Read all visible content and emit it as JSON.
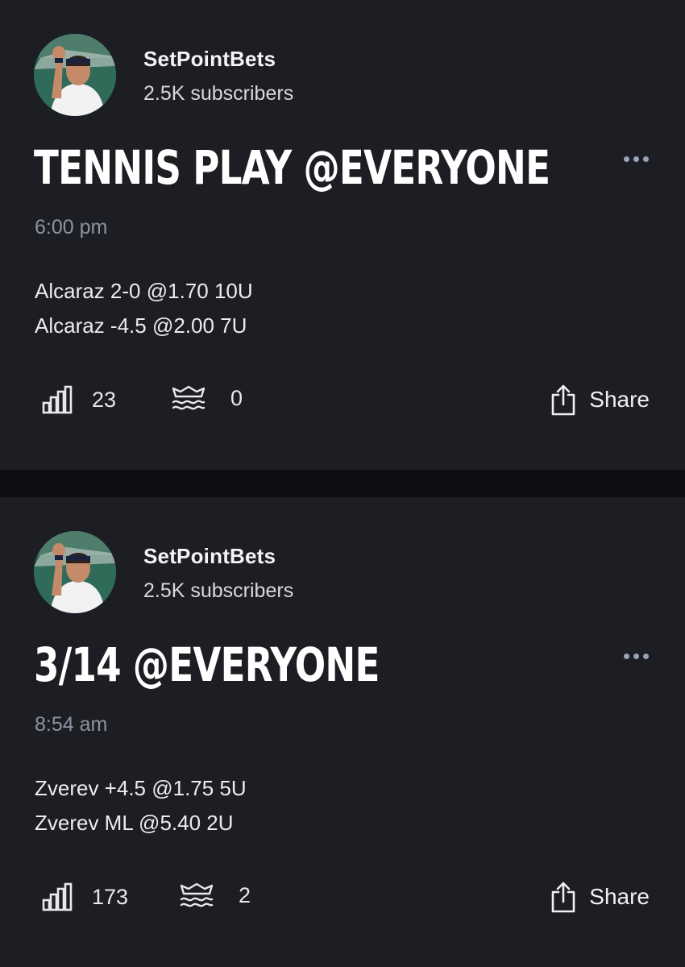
{
  "posts": [
    {
      "channel": "SetPointBets",
      "subscribers": "2.5K subscribers",
      "title": "TENNIS PLAY @EVERYONE",
      "time": "6:00 pm",
      "lines": [
        "Alcaraz 2-0 @1.70 10U",
        "Alcaraz -4.5 @2.00 7U"
      ],
      "views": "23",
      "reactions": "0",
      "share_label": "Share"
    },
    {
      "channel": "SetPointBets",
      "subscribers": "2.5K subscribers",
      "title": "3/14 @EVERYONE",
      "time": "8:54 am",
      "lines": [
        "Zverev +4.5 @1.75 5U",
        "Zverev ML @5.40 2U"
      ],
      "views": "173",
      "reactions": "2",
      "share_label": "Share"
    }
  ],
  "icons": {
    "views": "bar-chart-icon",
    "reactions": "wave-icon",
    "share": "share-icon",
    "more": "more-dots-icon"
  },
  "colors": {
    "background": "#0d0e11",
    "card": "#1d1e23",
    "muted_text": "#8d93a3",
    "dots": "#9aa3b8"
  }
}
